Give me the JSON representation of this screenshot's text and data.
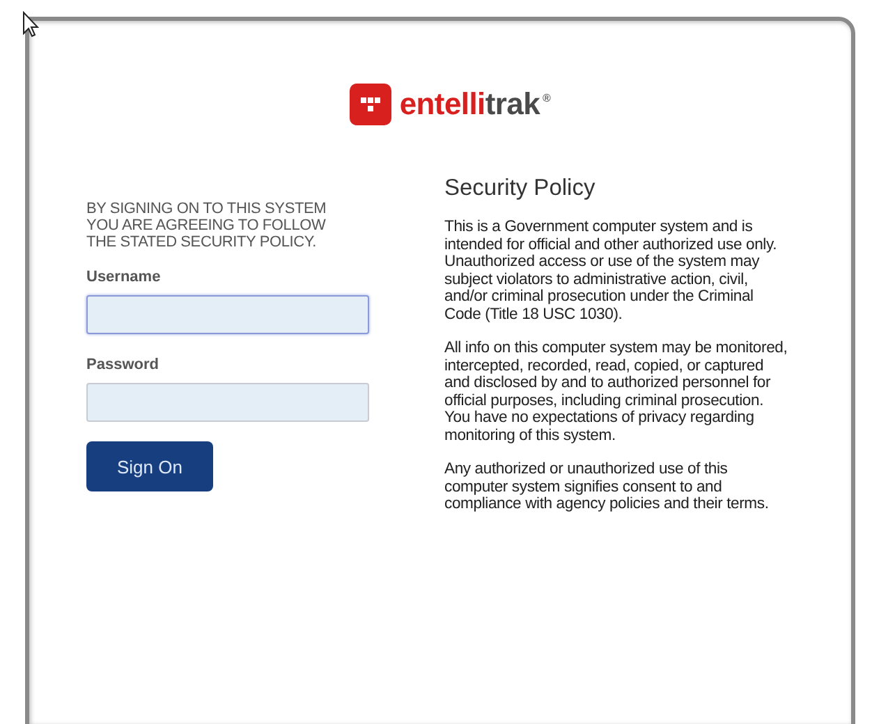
{
  "logo": {
    "parts": [
      {
        "text": "entelli",
        "color": "#d8201f"
      },
      {
        "text": "trak",
        "color": "#4a4a4a"
      }
    ],
    "mark": "®"
  },
  "login": {
    "notice": "BY SIGNING ON TO THIS SYSTEM YOU ARE AGREEING TO FOLLOW THE STATED SECURITY POLICY.",
    "fields": [
      {
        "label": "Username",
        "focused": true
      },
      {
        "label": "Password",
        "focused": false
      }
    ],
    "button": "Sign On"
  },
  "policy": {
    "title": "Security Policy",
    "paragraphs": [
      "This is a Government computer system and is intended for official and other authorized use only. Unauthorized access or use of the system may subject violators to administrative action, civil, and/or criminal prosecution under the Criminal Code (Title 18 USC 1030).",
      "All info on this computer system may be monitored, intercepted, recorded, read, copied, or captured and disclosed by and to authorized personnel for official purposes, including criminal prosecution. You have no expectations of privacy regarding monitoring of this system.",
      "Any authorized or unauthorized use of this computer system signifies consent to and compliance with agency policies and their terms."
    ]
  }
}
